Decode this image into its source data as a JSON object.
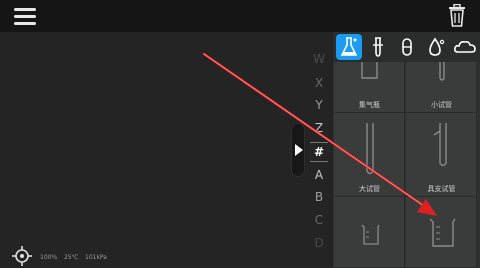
{
  "toolbar": {
    "menu_icon": "hamburger-menu-icon",
    "trash_icon": "trash-icon"
  },
  "status": {
    "target_icon": "crosshair-target-icon",
    "percent": "100%",
    "temperature": "25℃",
    "pressure": "101kPa"
  },
  "index": {
    "letters": [
      "W",
      "X",
      "Y",
      "Z",
      "#",
      "A",
      "B",
      "C",
      "D"
    ],
    "active": "#"
  },
  "categories": [
    {
      "icon": "flask-icon",
      "active": true
    },
    {
      "icon": "test-tube-icon",
      "active": false
    },
    {
      "icon": "capsule-icon",
      "active": false
    },
    {
      "icon": "droplet-icon",
      "active": false
    },
    {
      "icon": "cloud-icon",
      "active": false
    }
  ],
  "items": [
    {
      "label": "集气瓶",
      "icon": "gas-jar-icon"
    },
    {
      "label": "小试管",
      "icon": "small-test-tube-icon"
    },
    {
      "label": "大试管",
      "icon": "large-test-tube-icon"
    },
    {
      "label": "具支试管",
      "icon": "branched-test-tube-icon"
    },
    {
      "label": "",
      "icon": "small-beaker-icon"
    },
    {
      "label": "",
      "icon": "beaker-icon"
    }
  ],
  "colors": {
    "accent": "#1a9cf0",
    "arrow": "#e02020",
    "panel": "#2f3130",
    "topbar": "#151515"
  }
}
